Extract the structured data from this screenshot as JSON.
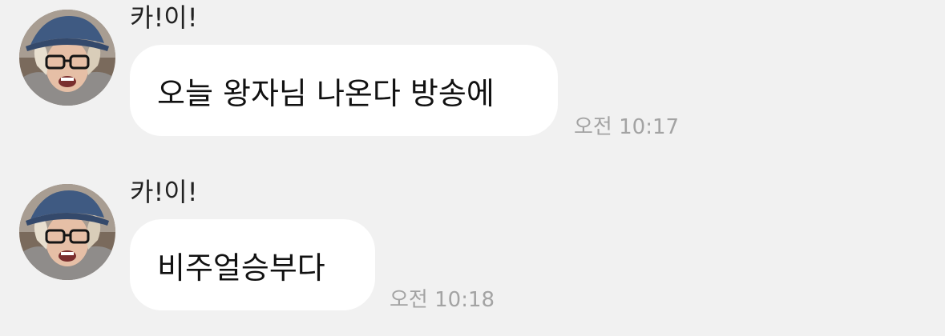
{
  "messages": [
    {
      "sender": "카!이!",
      "avatar": "profile-photo",
      "text": "오늘 왕자님 나온다 방송에",
      "time": "오전 10:17"
    },
    {
      "sender": "카!이!",
      "avatar": "profile-photo",
      "text": "비주얼승부다",
      "time": "오전 10:18"
    }
  ],
  "colors": {
    "background": "#f1f1f1",
    "bubble": "#ffffff",
    "time_text": "#a3a3a3",
    "sender_text": "#222222"
  }
}
